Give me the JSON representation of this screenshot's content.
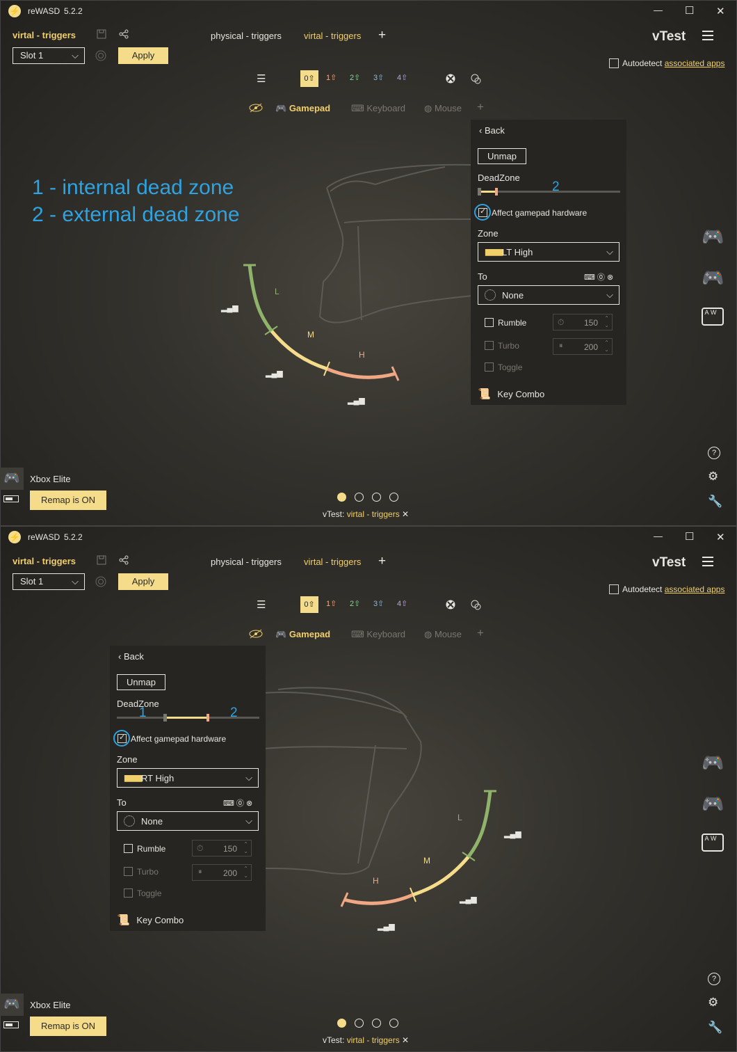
{
  "app": {
    "name": "reWASD",
    "version": "5.2.2"
  },
  "header": {
    "config_name": "virtal - triggers",
    "tabs": [
      "physical - triggers",
      "virtal - triggers"
    ],
    "add_tab": "+",
    "profile": "vTest",
    "slot": "Slot 1",
    "apply": "Apply",
    "autodetect_prefix": "Autodetect ",
    "autodetect_link": "associated apps"
  },
  "layers": [
    "0",
    "1",
    "2",
    "3",
    "4"
  ],
  "device_tabs": [
    "Gamepad",
    "Keyboard",
    "Mouse"
  ],
  "annotation": {
    "line1": "1 - internal dead zone",
    "line2": "2 - external dead zone",
    "mark1": "1",
    "mark2": "2"
  },
  "panel": {
    "back": "Back",
    "unmap": "Unmap",
    "deadzone": "DeadZone",
    "affect_hardware": "Affect gamepad hardware",
    "zone_label": "Zone",
    "to_label": "To",
    "to_value": "None",
    "rumble": "Rumble",
    "rumble_value": "150",
    "turbo": "Turbo",
    "turbo_value": "200",
    "toggle": "Toggle",
    "key_combo": "Key Combo"
  },
  "zones": {
    "top": "LT High",
    "bottom": "RT High"
  },
  "trigger_labels": {
    "low": "L",
    "mid": "M",
    "high": "H"
  },
  "device": {
    "name": "Xbox Elite",
    "remap": "Remap is ON"
  },
  "footer": {
    "profile": "vTest:",
    "config": "virtal - triggers",
    "close": "✕"
  },
  "window_controls": {
    "minimize": "—",
    "maximize": "☐",
    "close": "✕"
  },
  "colors": {
    "accent": "#f5dc8a",
    "annotation": "#2fa2e0",
    "arc_low": "#8fb36a",
    "arc_mid": "#f5dc8a",
    "arc_high": "#f0a884"
  }
}
